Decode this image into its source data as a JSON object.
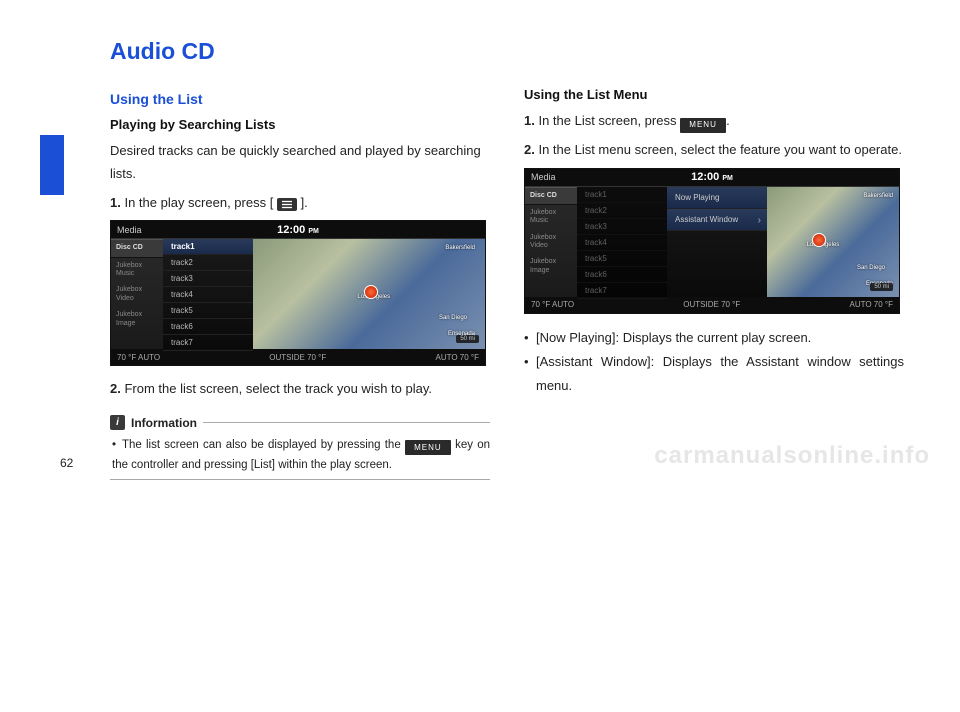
{
  "heading": "Audio CD",
  "left": {
    "subhead": "Using the List",
    "subsub": "Playing by Searching Lists",
    "intro": "Desired tracks can be quickly searched and played by searching lists.",
    "step1_prefix": "1.",
    "step1_text": " In the play screen, press [",
    "step1_suffix": "].",
    "step2_prefix": "2.",
    "step2_text": " From the list screen, select the track you wish to play.",
    "info_label": "Information",
    "info_text_a": "The list screen can also be displayed by pressing the ",
    "info_text_b": " key on the controller and pressing [List] within the play screen.",
    "menu_key": "MENU"
  },
  "right": {
    "subsub": "Using the List Menu",
    "step1_prefix": "1.",
    "step1_a": " In the List screen, press ",
    "step1_b": ".",
    "step2_prefix": "2.",
    "step2_text": " In the List menu screen, select the feature you want to operate.",
    "bullets": [
      "[Now Playing]: Displays the current play screen.",
      "[Assistant Window]: Displays the Assistant window settings menu."
    ],
    "menu_key": "MENU"
  },
  "screenshot": {
    "media_label": "Media",
    "clock": "12:00",
    "clock_ampm": "PM",
    "sidebar": [
      "Disc CD",
      "Jukebox Music",
      "Jukebox Video",
      "Jukebox Image"
    ],
    "tracks": [
      "track1",
      "track2",
      "track3",
      "track4",
      "track5",
      "track6",
      "track7"
    ],
    "menu_items": [
      "Now Playing",
      "Assistant Window"
    ],
    "map_cities": [
      "Bakersfield",
      "Los Angeles",
      "San Diego",
      "Ensenada"
    ],
    "map_scale": "50 mi",
    "footer_left": "70 °F    AUTO",
    "footer_mid": "OUTSIDE  70 °F",
    "footer_right": "AUTO    70 °F"
  },
  "page_number": "62",
  "watermark": "carmanualsonline.info"
}
